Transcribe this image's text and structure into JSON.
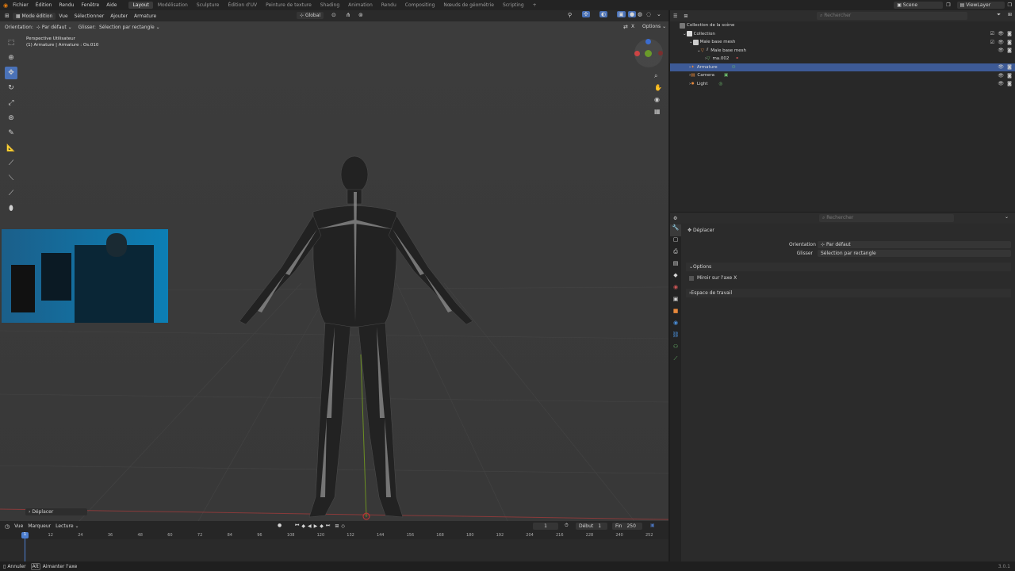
{
  "menu": {
    "items": [
      "Fichier",
      "Édition",
      "Rendu",
      "Fenêtre",
      "Aide"
    ]
  },
  "workspaces": {
    "tabs": [
      "Layout",
      "Modélisation",
      "Sculpture",
      "Édition d'UV",
      "Peinture de texture",
      "Shading",
      "Animation",
      "Rendu",
      "Compositing",
      "Nœuds de géométrie",
      "Scripting"
    ],
    "active": "Layout"
  },
  "scene": {
    "name": "Scene",
    "view_layer": "ViewLayer"
  },
  "viewport_header": {
    "mode": "Mode édition",
    "vue": "Vue",
    "selectionner": "Sélectionner",
    "ajouter": "Ajouter",
    "armature": "Armature",
    "global": "Global",
    "options": "Options"
  },
  "tool_settings": {
    "orientation_label": "Orientation:",
    "orientation_value": "Par défaut",
    "glisser_label": "Glisser:",
    "glisser_value": "Sélection par rectangle"
  },
  "viewport": {
    "perspective": "Perspective Utilisateur",
    "object_info": "(1) Armature | Armature : Os.010",
    "last_op": "Déplacer"
  },
  "outliner": {
    "search_placeholder": "Rechercher",
    "root": "Collection de la scène",
    "items": [
      {
        "label": "Collection"
      },
      {
        "label": "Male base mesh"
      },
      {
        "label": "Male base mesh"
      },
      {
        "label": "ma.002"
      },
      {
        "label": "Armature"
      },
      {
        "label": "Camera"
      },
      {
        "label": "Light"
      }
    ]
  },
  "properties": {
    "search_placeholder": "Rechercher",
    "tool_name": "Déplacer",
    "orientation_label": "Orientation",
    "orientation_value": "Par défaut",
    "glisser_label": "Glisser",
    "glisser_value": "Sélection par rectangle",
    "options_panel": "Options",
    "mirror_x": "Miroir sur l'axe X",
    "workspace_panel": "Espace de travail"
  },
  "timeline": {
    "vue": "Vue",
    "marqueur": "Marqueur",
    "lecture": "Lecture",
    "current_frame": "1",
    "debut_label": "Début",
    "debut": "1",
    "fin_label": "Fin",
    "fin": "250",
    "ticks": [
      "1",
      "12",
      "24",
      "36",
      "48",
      "60",
      "72",
      "84",
      "96",
      "108",
      "120",
      "132",
      "144",
      "156",
      "168",
      "180",
      "192",
      "204",
      "216",
      "228",
      "240",
      "252"
    ]
  },
  "status": {
    "annuler": "Annuler",
    "alt": "Alt",
    "aimanter": "Aimanter l'axe",
    "version": "3.0.1"
  },
  "colors": {
    "accent": "#4a72b8",
    "selection": "#3d5a96",
    "timeline_cursor": "#4d7fd0"
  }
}
